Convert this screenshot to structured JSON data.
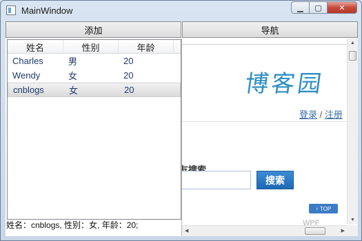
{
  "window": {
    "title": "MainWindow",
    "min_label": "▁",
    "max_label": "▢",
    "close_label": "✕"
  },
  "toolbar": {
    "add_label": "添加",
    "nav_label": "导航"
  },
  "list": {
    "columns": [
      "姓名",
      "性别",
      "年龄"
    ],
    "rows": [
      {
        "name": "Charles",
        "gender": "男",
        "age": "20"
      },
      {
        "name": "Wendy",
        "gender": "女",
        "age": "20"
      },
      {
        "name": "cnblogs",
        "gender": "女",
        "age": "20"
      }
    ],
    "selected_index": 2
  },
  "status": {
    "text": "姓名：cnblogs, 性别：女, 年龄：20;"
  },
  "browser": {
    "logo_text": "博客园",
    "login_label": "登录",
    "separator": "/",
    "register_label": "注册",
    "search_label": "友搜索",
    "search_value": "",
    "search_button": "搜索",
    "top_badge": "↑ TOP",
    "watermark": "WPF"
  },
  "colors": {
    "accent": "#2f8fc2",
    "search_button": "#1f68b3",
    "close_button": "#c6493a"
  }
}
